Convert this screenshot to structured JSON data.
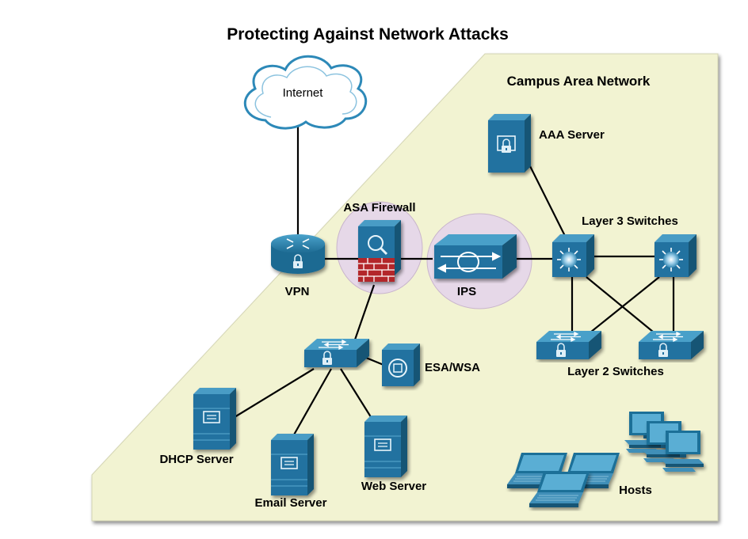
{
  "title": "Protecting Against Network Attacks",
  "area_title": "Campus Area Network",
  "labels": {
    "internet": "Internet",
    "vpn": "VPN",
    "asa_firewall": "ASA Firewall",
    "ips": "IPS",
    "aaa_server": "AAA Server",
    "layer3_switches": "Layer 3 Switches",
    "layer2_switches": "Layer 2 Switches",
    "esa_wsa": "ESA/WSA",
    "dhcp_server": "DHCP Server",
    "email_server": "Email Server",
    "web_server": "Web Server",
    "hosts": "Hosts"
  },
  "colors": {
    "campus_fill": "#f2f3d2",
    "highlight": "#e6d8e8",
    "device_blue": "#1f6f98",
    "device_light": "#3f94bd",
    "device_dark": "#155574",
    "firewall_red": "#b3262a"
  }
}
